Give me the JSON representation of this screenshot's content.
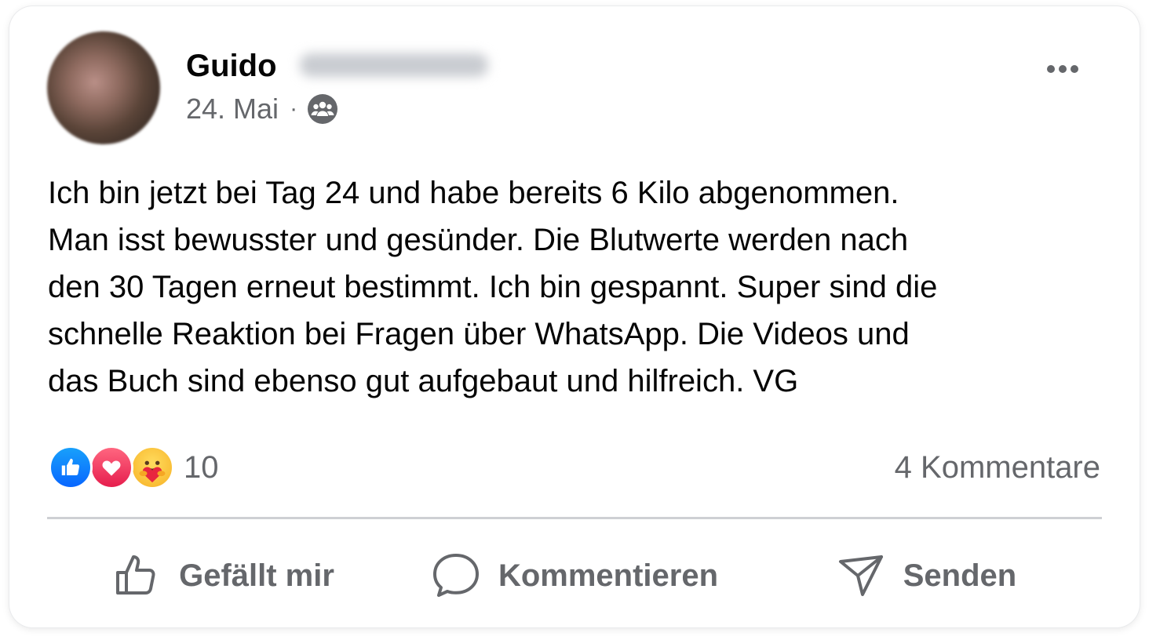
{
  "post": {
    "author": "Guido",
    "date": "24. Mai",
    "separator": "·",
    "audience_icon": "group-icon",
    "text": "Ich bin jetzt bei Tag 24 und habe bereits 6 Kilo abgenommen.\nMan isst bewusster und gesünder. Die Blutwerte werden nach\nden 30 Tagen erneut bestimmt. Ich bin gespannt. Super sind die\nschnelle Reaktion bei Fragen über WhatsApp. Die Videos und\ndas Buch sind ebenso gut aufgebaut und hilfreich. VG"
  },
  "stats": {
    "reaction_count": "10",
    "reaction_types": [
      "like",
      "love",
      "care"
    ],
    "comments": "4 Kommentare"
  },
  "actions": {
    "like": "Gefällt mir",
    "comment": "Kommentieren",
    "share": "Senden"
  },
  "colors": {
    "text_primary": "#050505",
    "text_secondary": "#65676b",
    "like_blue": "#0866ff",
    "love_red": "#e61e4d",
    "care_yellow": "#f7b125",
    "divider": "#ced0d4"
  }
}
